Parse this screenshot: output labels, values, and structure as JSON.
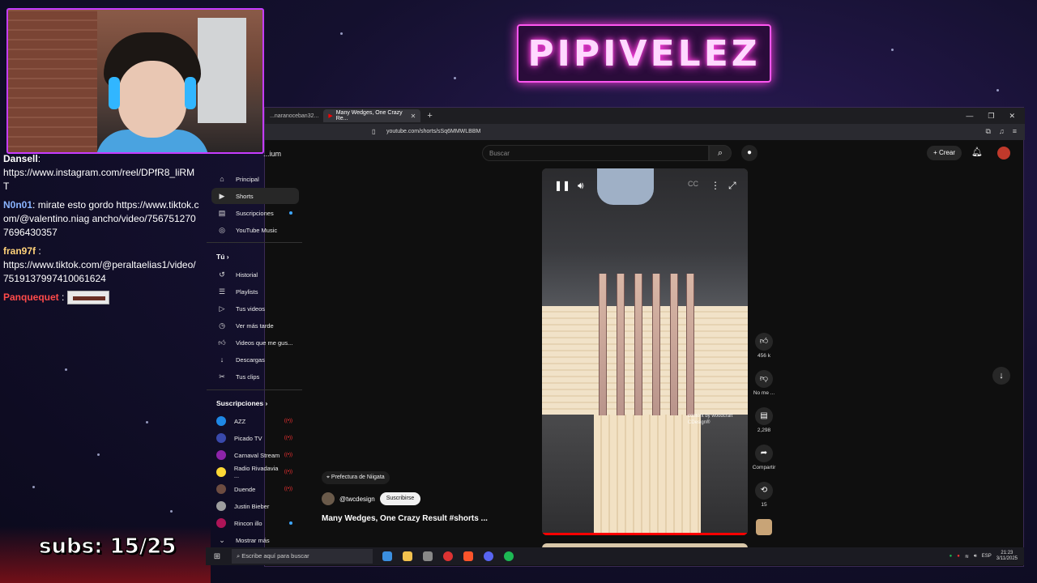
{
  "overlay": {
    "logo_text": "PIPIVELEZ",
    "subs_text": "subs: 15/25",
    "chat": [
      {
        "user": "Dansell",
        "user_color": "#ffffff",
        "text": "https://www.instagram.com/reel/DPfR8_liRMT"
      },
      {
        "user": "N0n01",
        "user_color": "#8ab4ff",
        "text": "mirate esto gordo https://www.tiktok.com/@valentino.niag ancho/video/7567512707696430357"
      },
      {
        "user": "fran97f",
        "user_color": "#ffd27a",
        "text": "https://www.tiktok.com/@peraltaelias1/video/7519137997410061624"
      },
      {
        "user": "Panquequet",
        "user_color": "#ff4a4a",
        "text": ""
      }
    ]
  },
  "browser": {
    "tabs": [
      {
        "label": "...naranoceban32..."
      },
      {
        "label": "Many Wedges, One Crazy Re..."
      }
    ],
    "url": "youtube.com/shorts/sSq6MMWLBBM"
  },
  "youtube": {
    "brand": "...ium",
    "search_placeholder": "Buscar",
    "create_label": "Crear",
    "sidebar": {
      "main": [
        {
          "label": "Principal",
          "icon": "home-icon"
        },
        {
          "label": "Shorts",
          "icon": "shorts-icon"
        },
        {
          "label": "Suscripciones",
          "icon": "subscriptions-icon"
        },
        {
          "label": "YouTube Music",
          "icon": "music-icon"
        }
      ],
      "you_heading": "Tú",
      "you": [
        {
          "label": "Historial",
          "icon": "history-icon"
        },
        {
          "label": "Playlists",
          "icon": "playlists-icon"
        },
        {
          "label": "Tus videos",
          "icon": "your-videos-icon"
        },
        {
          "label": "Ver más tarde",
          "icon": "watch-later-icon"
        },
        {
          "label": "Videos que me gus...",
          "icon": "liked-icon"
        },
        {
          "label": "Descargas",
          "icon": "downloads-icon"
        },
        {
          "label": "Tus clips",
          "icon": "clips-icon"
        }
      ],
      "subs_heading": "Suscripciones",
      "subscriptions": [
        {
          "label": "AZZ",
          "color": "#1e88e5"
        },
        {
          "label": "Picado TV",
          "color": "#3949ab"
        },
        {
          "label": "Carnaval Stream",
          "color": "#8e24aa"
        },
        {
          "label": "Radio Rivadavia ...",
          "color": "#fdd835"
        },
        {
          "label": "Duende",
          "color": "#6d4c41"
        },
        {
          "label": "Justin Bieber",
          "color": "#9e9e9e"
        },
        {
          "label": "Rincon illo",
          "color": "#ad1457"
        }
      ],
      "show_more": "Mostrar más"
    },
    "short": {
      "watermark": "content by woodcraft CDesign®",
      "location": "Prefectura de Niigata",
      "channel": "@twcdesign",
      "subscribe_label": "Suscribirse",
      "title": "Many Wedges, One Crazy Result #shorts ...",
      "likes": "456 k",
      "dislike_label": "No me ...",
      "comments": "2,298",
      "share_label": "Compartir",
      "remix": "15"
    }
  },
  "taskbar": {
    "search_placeholder": "Escribe aquí para buscar",
    "time": "21:23",
    "date": "3/11/2025"
  }
}
